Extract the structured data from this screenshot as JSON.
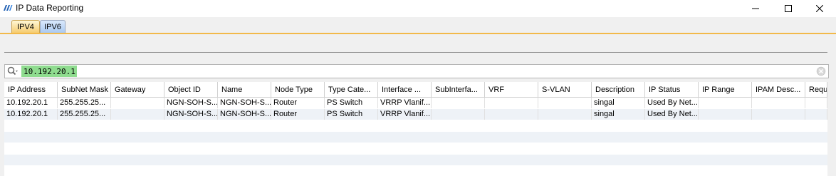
{
  "window": {
    "title": "IP Data Reporting",
    "minimize_icon": "minimize-icon",
    "maximize_icon": "maximize-icon",
    "close_icon": "close-icon"
  },
  "tabs": [
    {
      "label": "IPV4",
      "active": true
    },
    {
      "label": "IPV6",
      "active": false
    }
  ],
  "search": {
    "value": "10.192.20.1",
    "icon": "search-icon"
  },
  "table": {
    "columns": [
      "IP Address",
      "SubNet Mask",
      "Gateway",
      "Object ID",
      "Name",
      "Node Type",
      "Type Cate...",
      "Interface ...",
      "SubInterfa...",
      "VRF",
      "S-VLAN",
      "Description",
      "IP Status",
      "IP Range",
      "IPAM Desc...",
      "Requ"
    ],
    "rows": [
      [
        "10.192.20.1",
        "255.255.25...",
        "",
        "NGN-SOH-S...",
        "NGN-SOH-S...",
        "Router",
        "PS Switch",
        "VRRP  Vlanif...",
        "",
        "",
        "",
        "singal",
        "Used By Net...",
        "",
        "",
        ""
      ],
      [
        "10.192.20.1",
        "255.255.25...",
        "",
        "NGN-SOH-S...",
        "NGN-SOH-S...",
        "Router",
        "PS Switch",
        "VRRP  Vlanif...",
        "",
        "",
        "",
        "singal",
        "Used By Net...",
        "",
        "",
        ""
      ]
    ]
  },
  "colors": {
    "active_tab": "#f5c96a",
    "inactive_tab": "#a8c8f0",
    "search_highlight": "#8fdc8f",
    "row_alt": "#eef2f7"
  }
}
